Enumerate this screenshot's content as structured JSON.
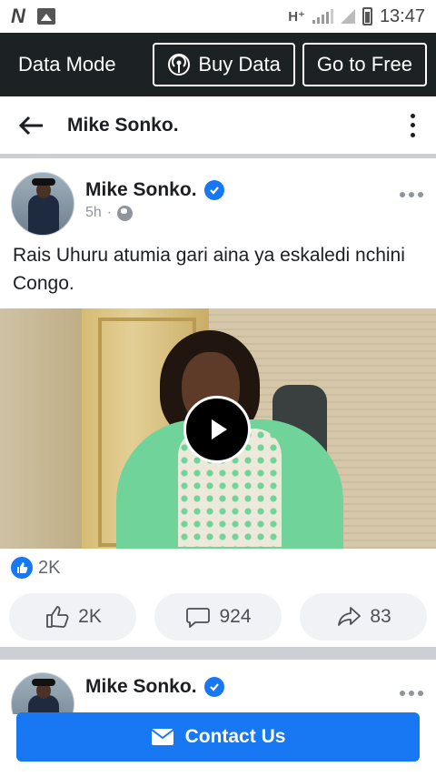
{
  "status_bar": {
    "network": "H⁺",
    "time": "13:47"
  },
  "data_bar": {
    "mode_label": "Data Mode",
    "buy_data_label": "Buy Data",
    "go_free_label": "Go to Free"
  },
  "top_nav": {
    "title": "Mike Sonko."
  },
  "post": {
    "author": "Mike Sonko.",
    "time": "5h",
    "separator": "·",
    "text": "Rais Uhuru atumia gari aina ya eskaledi nchini Congo.",
    "reaction_count": "2K",
    "actions": {
      "like_count": "2K",
      "comment_count": "924",
      "share_count": "83"
    }
  },
  "post2": {
    "author": "Mike Sonko."
  },
  "contact_button": {
    "label": "Contact Us"
  },
  "colors": {
    "accent": "#1877f2",
    "data_bar_bg": "#1c2124",
    "action_bg": "#f0f2f5"
  },
  "icons": [
    "back-arrow-icon",
    "more-vert-icon",
    "verified-icon",
    "globe-icon",
    "more-horizontal-icon",
    "play-icon",
    "like-icon",
    "comment-icon",
    "share-icon",
    "mail-icon",
    "wifi-signal-icon"
  ]
}
